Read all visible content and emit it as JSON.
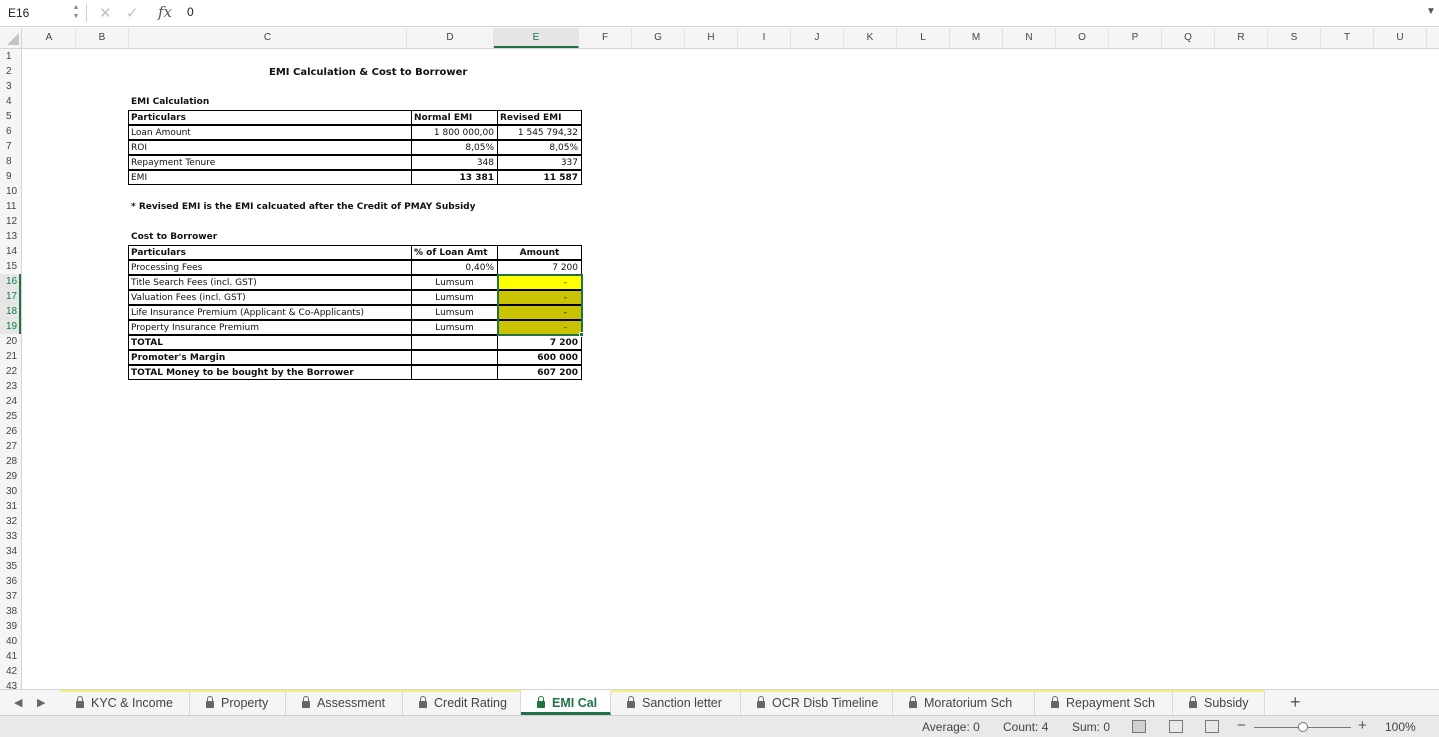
{
  "formula_bar": {
    "name_box": "E16",
    "cancel_icon": "✕",
    "confirm_icon": "✓",
    "fx_label": "fx",
    "formula_value": "0",
    "expand_icon": "▼"
  },
  "columns": [
    "A",
    "B",
    "C",
    "D",
    "E",
    "F",
    "G",
    "H",
    "I",
    "J",
    "K",
    "L",
    "M",
    "N",
    "O",
    "P",
    "Q",
    "R",
    "S",
    "T",
    "U"
  ],
  "selected_column": "E",
  "rows": [
    "1",
    "2",
    "3",
    "4",
    "5",
    "6",
    "7",
    "8",
    "9",
    "10",
    "11",
    "12",
    "13",
    "14",
    "15",
    "16",
    "17",
    "18",
    "19",
    "20",
    "21",
    "22",
    "23",
    "24",
    "25",
    "26",
    "27",
    "28",
    "29",
    "30",
    "31",
    "32",
    "33",
    "34",
    "35",
    "36",
    "37",
    "38",
    "39",
    "40",
    "41",
    "42",
    "43"
  ],
  "selected_rows": [
    "16",
    "17",
    "18",
    "19"
  ],
  "sheet": {
    "title": "EMI Calculation & Cost to Borrower",
    "emi_section": {
      "heading": "EMI Calculation",
      "headers": [
        "Particulars",
        "Normal EMI",
        "Revised EMI"
      ],
      "rows": [
        [
          "Loan Amount",
          "1 800 000,00",
          "1 545 794,32"
        ],
        [
          "ROI",
          "8,05%",
          "8,05%"
        ],
        [
          "Repayment Tenure",
          "348",
          "337"
        ],
        [
          "EMI",
          "13 381",
          "11 587"
        ]
      ]
    },
    "note": "* Revised EMI is the EMI calcuated after the Credit of PMAY Subsidy",
    "cost_section": {
      "heading": "Cost to Borrower",
      "headers": [
        "Particulars",
        "% of Loan Amt",
        "Amount"
      ],
      "rows": [
        [
          "Processing Fees",
          "0,40%",
          "7 200"
        ],
        [
          "Title Search Fees (incl. GST)",
          "Lumsum",
          "-"
        ],
        [
          "Valuation Fees (incl. GST)",
          "Lumsum",
          "-"
        ],
        [
          "Life Insurance Premium (Applicant & Co-Applicants)",
          "Lumsum",
          "-"
        ],
        [
          "Property Insurance Premium",
          "Lumsum",
          "-"
        ]
      ],
      "totals": [
        [
          "TOTAL",
          "",
          "7 200"
        ],
        [
          "Promoter's Margin",
          "",
          "600 000"
        ],
        [
          "TOTAL Money to be bought by the Borrower",
          "",
          "607 200"
        ]
      ]
    }
  },
  "tabs": {
    "nav_prev": "◀",
    "nav_next": "▶",
    "items": [
      "KYC & Income",
      "Property",
      "Assessment",
      "Credit Rating",
      "EMI Cal",
      "Sanction letter",
      "OCR Disb Timeline",
      "Moratorium Sch",
      "Repayment Sch",
      "Subsidy"
    ],
    "active": "EMI Cal",
    "add_label": "+"
  },
  "status": {
    "average": "Average: 0",
    "count": "Count: 4",
    "sum": "Sum: 0",
    "zoom_minus": "−",
    "zoom_plus": "+",
    "zoom": "100%"
  },
  "colors": {
    "accent": "#217346",
    "highlight_yellow": "#ffff00",
    "highlight_olive": "#c9c300"
  }
}
